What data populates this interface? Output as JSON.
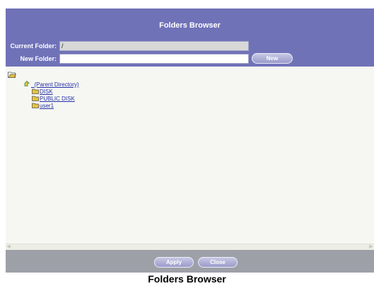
{
  "window": {
    "title": "Folders Browser",
    "current_folder_label": "Current Folder:",
    "current_folder_value": "/",
    "new_folder_label": "New Folder:",
    "new_folder_value": "",
    "new_button": "New",
    "apply_button": "Apply",
    "close_button": "Close"
  },
  "tree": {
    "parent": "_(Parent Directory)",
    "items": [
      "DISK",
      "PUBLIC DISK",
      "user1"
    ]
  },
  "caption": "Folders Browser",
  "colors": {
    "header": "#7072b8",
    "footer": "#9ea0a8",
    "link": "#2530a8",
    "folder": "#e8c23a"
  },
  "icons": {
    "root": "open-folder-icon",
    "parent": "parent-directory-icon",
    "item": "folder-icon"
  }
}
